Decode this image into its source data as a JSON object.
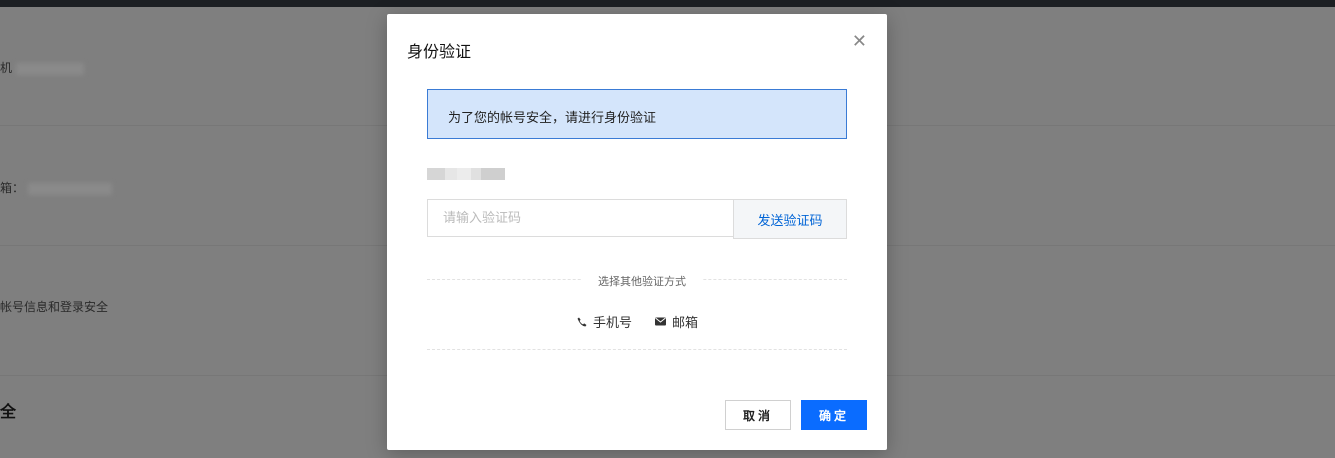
{
  "background": {
    "phone_label": "机",
    "email_label": "箱：",
    "security_desc": "帐号信息和登录安全",
    "section_heading": "全"
  },
  "modal": {
    "title": "身份验证",
    "close_icon": "close-icon",
    "notice": "为了您的帐号安全，请进行身份验证",
    "code_input": {
      "placeholder": "请输入验证码",
      "value": ""
    },
    "send_code_label": "发送验证码",
    "other_methods_label": "选择其他验证方式",
    "methods": [
      {
        "label": "手机号",
        "icon": "phone-icon"
      },
      {
        "label": "邮箱",
        "icon": "mail-icon"
      }
    ],
    "cancel_label": "取消",
    "confirm_label": "确定"
  },
  "colors": {
    "accent": "#0a6cff",
    "notice_bg": "#d4e5fb",
    "notice_border": "#3a7bd5",
    "overlay": "#7f7f7f"
  }
}
